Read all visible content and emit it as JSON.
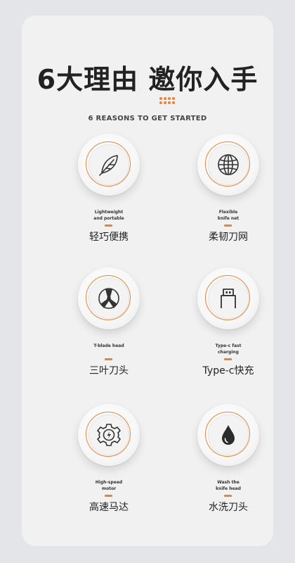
{
  "header": {
    "title": "6大理由 邀你入手",
    "subtitle": "6 REASONS TO GET STARTED"
  },
  "colors": {
    "accent": "#e8833a",
    "text": "#222222",
    "card": "#f1f1f1"
  },
  "features": [
    {
      "icon": "feather-icon",
      "en": "Lightweight\nand portable",
      "zh": "轻巧便携"
    },
    {
      "icon": "globe-net-icon",
      "en": "Flexible\nknife net",
      "zh": "柔韧刀网"
    },
    {
      "icon": "t-blade-icon",
      "en": "T-blade head",
      "zh": "三叶刀头"
    },
    {
      "icon": "usb-type-c-icon",
      "en": "Type-c fast\ncharging",
      "zh": "Type-c快充"
    },
    {
      "icon": "motor-gear-icon",
      "en": "High-speed\nmotor",
      "zh": "高速马达"
    },
    {
      "icon": "water-drop-icon",
      "en": "Wash the\nknife head",
      "zh": "水洗刀头"
    }
  ]
}
